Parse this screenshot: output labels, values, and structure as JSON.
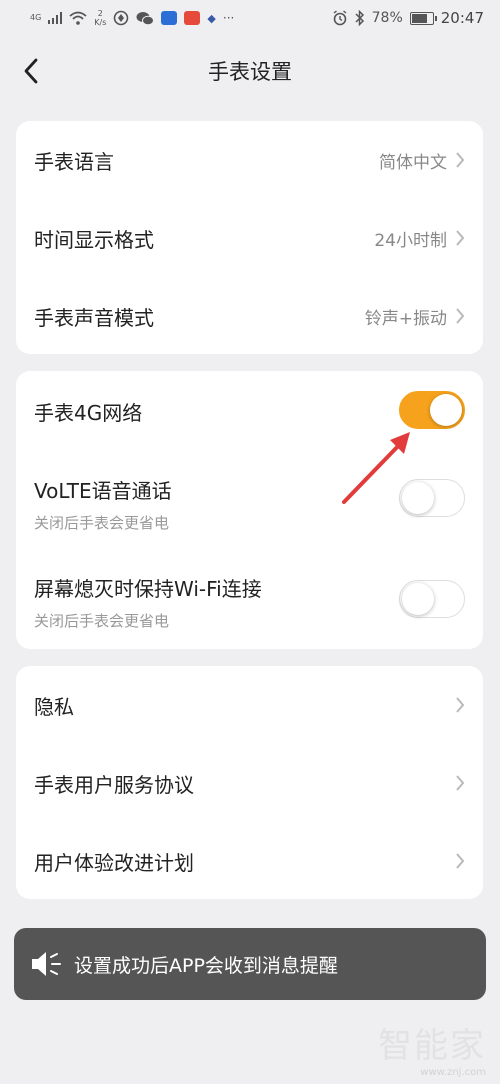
{
  "status_bar": {
    "network": "4G",
    "speed_value": "2",
    "speed_unit": "K/s",
    "battery": "78%",
    "battery_level": 0.78,
    "time": "20:47",
    "more": "···"
  },
  "header": {
    "title": "手表设置"
  },
  "group1": {
    "items": [
      {
        "label": "手表语言",
        "value": "简体中文"
      },
      {
        "label": "时间显示格式",
        "value": "24小时制"
      },
      {
        "label": "手表声音模式",
        "value": "铃声+振动"
      }
    ]
  },
  "group2": {
    "items": [
      {
        "label": "手表4G网络",
        "sub": "",
        "on": true
      },
      {
        "label": "VoLTE语音通话",
        "sub": "关闭后手表会更省电",
        "on": false
      },
      {
        "label": "屏幕熄灭时保持Wi-Fi连接",
        "sub": "关闭后手表会更省电",
        "on": false
      }
    ]
  },
  "group3": {
    "items": [
      {
        "label": "隐私"
      },
      {
        "label": "手表用户服务协议"
      },
      {
        "label": "用户体验改进计划"
      }
    ]
  },
  "toast": {
    "text": "设置成功后APP会收到消息提醒",
    "icon": "speaker-icon"
  },
  "watermark": {
    "brand": "智能家",
    "url": "www.znj.com"
  },
  "colors": {
    "accent": "#f6a21c",
    "annotation": "#e23b3b",
    "background": "#efeff1"
  }
}
